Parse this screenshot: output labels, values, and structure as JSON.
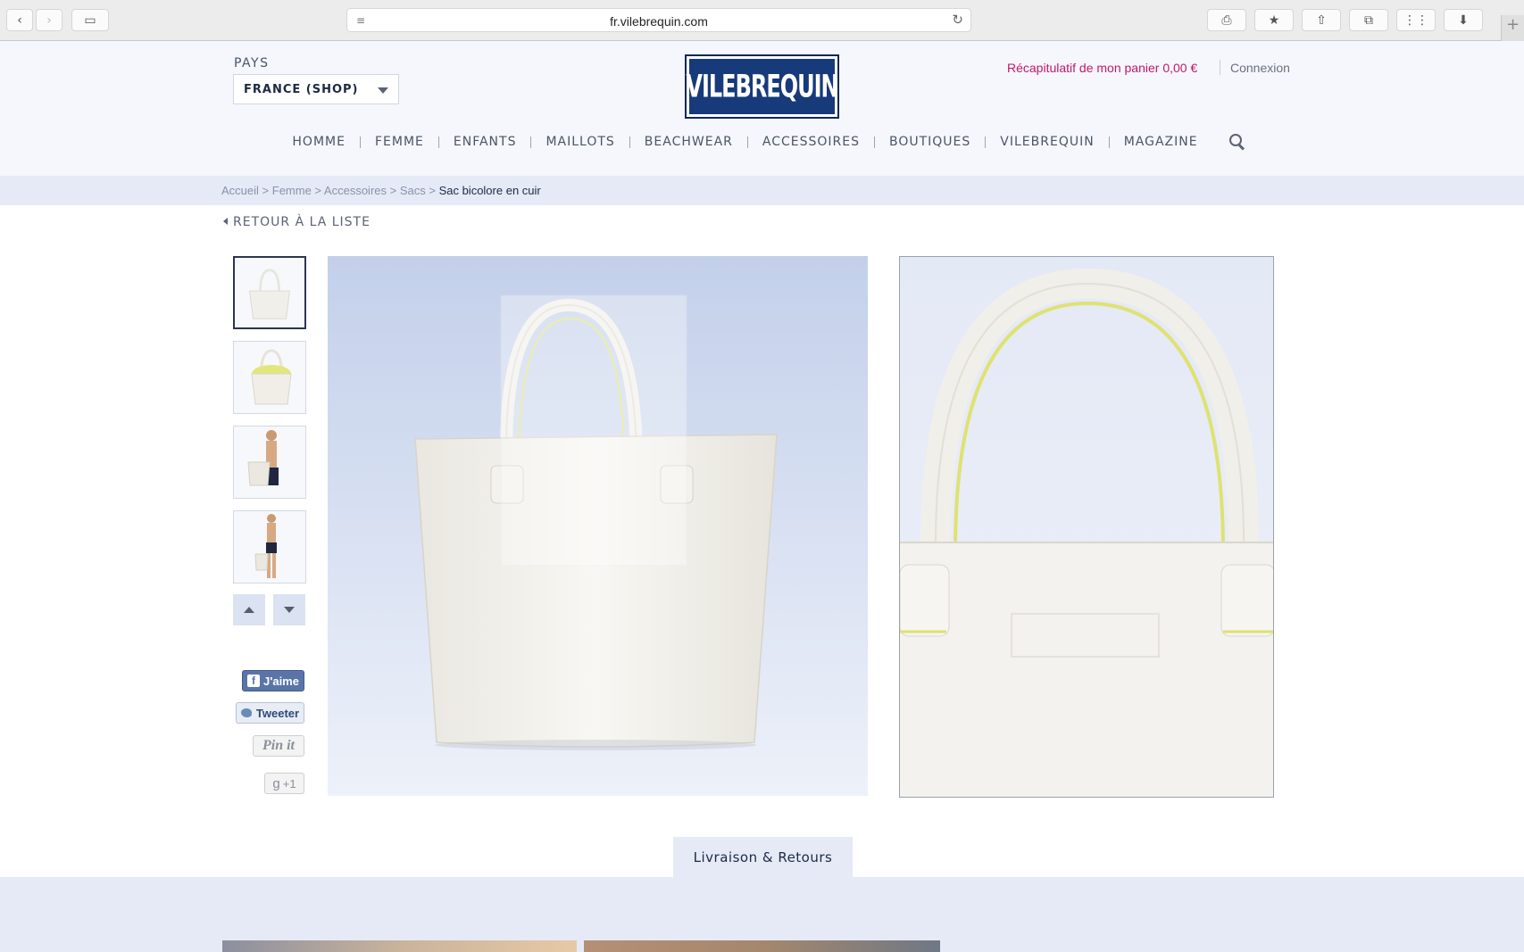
{
  "browser": {
    "url": "fr.vilebrequin.com",
    "back_glyph": "‹",
    "forward_glyph": "›",
    "sidebar_glyph": "▭",
    "reader_glyph": "≡",
    "reload_glyph": "↻",
    "print_glyph": "⎙",
    "bookmark_glyph": "★",
    "share_glyph": "⇧",
    "tabs_glyph": "⧉",
    "grid_glyph": "⋮⋮",
    "download_glyph": "⬇",
    "newtab_glyph": "+"
  },
  "header": {
    "pays_label": "PAYS",
    "pays_value": "FRANCE (SHOP)",
    "logo_text": "VILEBREQUIN",
    "cart_summary": "Récapitulatif de mon panier 0,00 €",
    "login": "Connexion"
  },
  "nav": {
    "items": [
      "HOMME",
      "FEMME",
      "ENFANTS",
      "MAILLOTS",
      "BEACHWEAR",
      "ACCESSOIRES",
      "BOUTIQUES",
      "VILEBREQUIN",
      "MAGAZINE"
    ]
  },
  "breadcrumb": {
    "items": [
      "Accueil",
      "Femme",
      "Accessoires",
      "Sacs"
    ],
    "separator": " > ",
    "current": "Sac bicolore en cuir"
  },
  "back_link": "RETOUR À LA LISTE",
  "social": {
    "facebook": "J'aime",
    "twitter": "Tweeter",
    "pinterest": "Pin it",
    "gplus": "+1"
  },
  "tabs": {
    "delivery": "Livraison & Retours"
  },
  "colors": {
    "accent_pink": "#c3176d",
    "navy": "#173a7a",
    "light_band": "#e5eaf6"
  }
}
